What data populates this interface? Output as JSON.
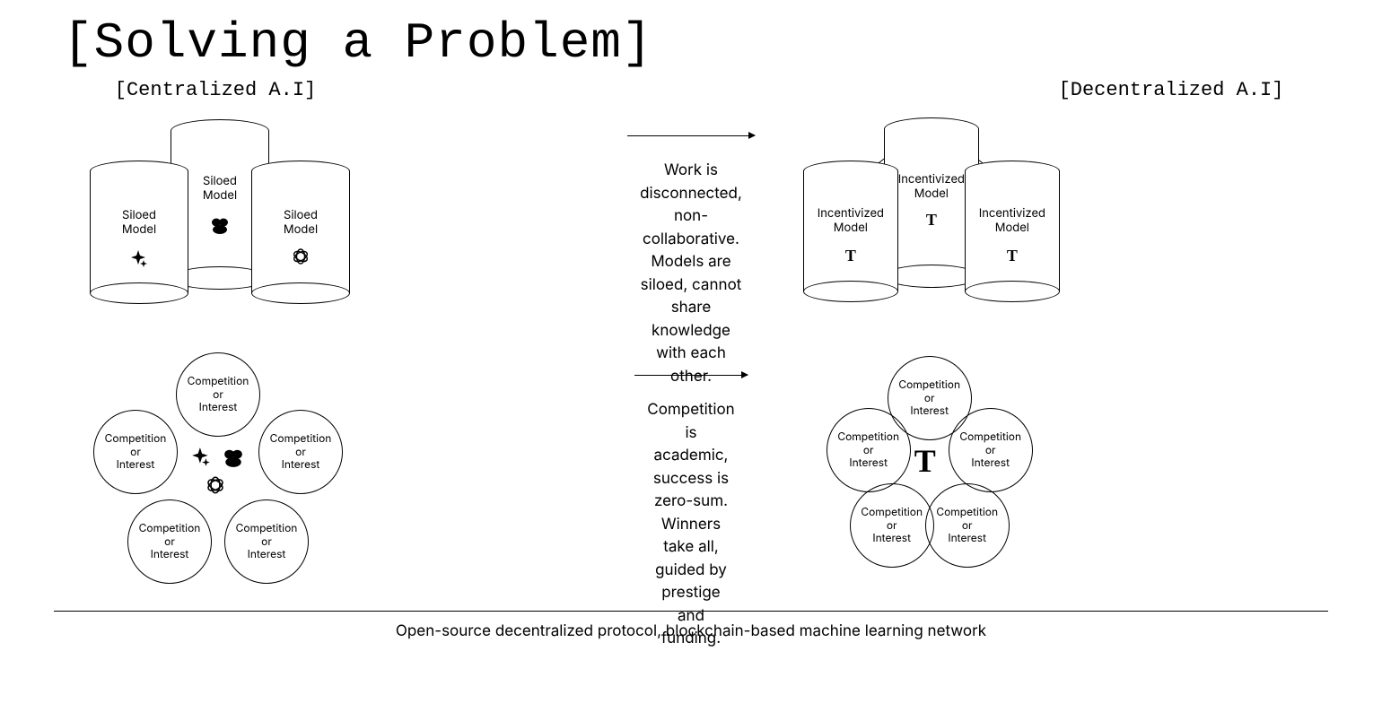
{
  "title": "[Solving a Problem]",
  "headers": {
    "left": "[Centralized A.I]",
    "right": "[Decentralized A.I]"
  },
  "row1": {
    "silo_label_line1": "Siloed",
    "silo_label_line2": "Model",
    "silo_icons": [
      "sparkle-icon",
      "dots-icon",
      "openai-icon"
    ],
    "mid_text": "Work is disconnected, non-collaborative. Models are siloed, cannot share knowledge with each other.",
    "incent_label_line1": "Incentivized",
    "incent_label_line2": "Model",
    "incent_icon": "tau-icon"
  },
  "row2": {
    "circle_label_line1": "Competition",
    "circle_label_line2": "or",
    "circle_label_line3": "Interest",
    "center_icons_left": [
      "sparkle-icon",
      "dots-icon",
      "openai-icon"
    ],
    "mid_text": "Competition is academic, success is zero-sum. Winners take all, guided by prestige and funding.",
    "center_icon_right": "tau-icon"
  },
  "footer": "Open-source decentralized protocol, blockchain-based machine learning network"
}
